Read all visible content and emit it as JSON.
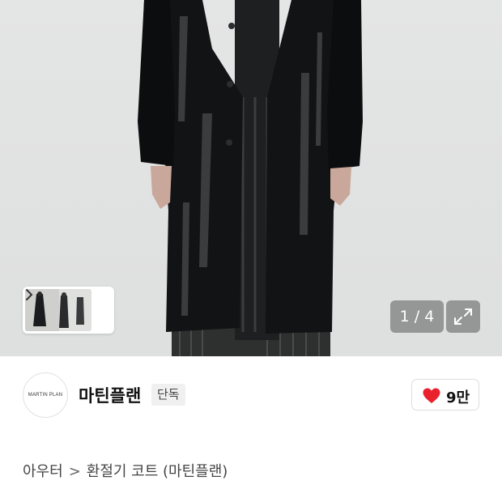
{
  "gallery": {
    "counter_current": "1",
    "counter_separator": " / ",
    "counter_total": "4",
    "background": "#dfe0e0"
  },
  "brand": {
    "logo_text": "MARTIN PLAN",
    "name": "마틴플랜",
    "exclusive_badge": "단독",
    "likes": "9만",
    "heart_color": "#e8212d"
  },
  "breadcrumb": {
    "level1": "아우터",
    "level2": "환절기 코트 (마틴플랜)"
  },
  "icons": {
    "thumb_arrow": "chevron-right-icon",
    "expand": "expand-icon",
    "like": "heart-icon"
  }
}
